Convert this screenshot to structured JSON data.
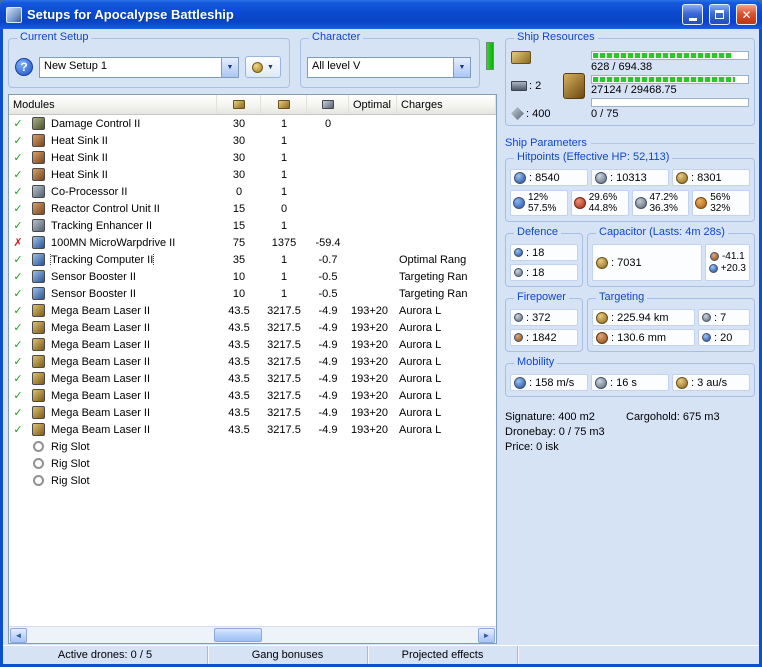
{
  "window": {
    "title": "Setups for Apocalypse Battleship"
  },
  "setup": {
    "group_label": "Current Setup",
    "value": "New Setup 1",
    "help_label": "?"
  },
  "character": {
    "group_label": "Character",
    "value": "All level V"
  },
  "modules": {
    "header_label": "Modules",
    "col_optimal": "Optimal",
    "col_charges": "Charges",
    "rows": [
      {
        "status": "ok",
        "icon": "dc",
        "name": "Damage Control II",
        "cpu": "30",
        "pg": "1",
        "cap": "0"
      },
      {
        "status": "ok",
        "icon": "hs",
        "name": "Heat Sink II",
        "cpu": "30",
        "pg": "1"
      },
      {
        "status": "ok",
        "icon": "hs",
        "name": "Heat Sink II",
        "cpu": "30",
        "pg": "1"
      },
      {
        "status": "ok",
        "icon": "hs",
        "name": "Heat Sink II",
        "cpu": "30",
        "pg": "1"
      },
      {
        "status": "ok",
        "icon": "cp",
        "name": "Co-Processor II",
        "cpu": "0",
        "pg": "1"
      },
      {
        "status": "ok",
        "icon": "rcu",
        "name": "Reactor Control Unit II",
        "cpu": "15",
        "pg": "0"
      },
      {
        "status": "ok",
        "icon": "te",
        "name": "Tracking Enhancer II",
        "cpu": "15",
        "pg": "1"
      },
      {
        "status": "error",
        "icon": "mwd",
        "name": "100MN MicroWarpdrive II",
        "cpu": "75",
        "pg": "1375",
        "cap": "-59.4"
      },
      {
        "status": "ok",
        "icon": "tc",
        "name": "Tracking Computer II",
        "cpu": "35",
        "pg": "1",
        "cap": "-0.7",
        "charge": "Optimal Rang",
        "selected": true
      },
      {
        "status": "ok",
        "icon": "sb",
        "name": "Sensor Booster II",
        "cpu": "10",
        "pg": "1",
        "cap": "-0.5",
        "charge": "Targeting Ran"
      },
      {
        "status": "ok",
        "icon": "sb",
        "name": "Sensor Booster II",
        "cpu": "10",
        "pg": "1",
        "cap": "-0.5",
        "charge": "Targeting Ran"
      },
      {
        "status": "ok",
        "icon": "laser",
        "name": "Mega Beam Laser II",
        "cpu": "43.5",
        "pg": "3217.5",
        "cap": "-4.9",
        "optimal": "193+20",
        "charge": "Aurora L"
      },
      {
        "status": "ok",
        "icon": "laser",
        "name": "Mega Beam Laser II",
        "cpu": "43.5",
        "pg": "3217.5",
        "cap": "-4.9",
        "optimal": "193+20",
        "charge": "Aurora L"
      },
      {
        "status": "ok",
        "icon": "laser",
        "name": "Mega Beam Laser II",
        "cpu": "43.5",
        "pg": "3217.5",
        "cap": "-4.9",
        "optimal": "193+20",
        "charge": "Aurora L"
      },
      {
        "status": "ok",
        "icon": "laser",
        "name": "Mega Beam Laser II",
        "cpu": "43.5",
        "pg": "3217.5",
        "cap": "-4.9",
        "optimal": "193+20",
        "charge": "Aurora L"
      },
      {
        "status": "ok",
        "icon": "laser",
        "name": "Mega Beam Laser II",
        "cpu": "43.5",
        "pg": "3217.5",
        "cap": "-4.9",
        "optimal": "193+20",
        "charge": "Aurora L"
      },
      {
        "status": "ok",
        "icon": "laser",
        "name": "Mega Beam Laser II",
        "cpu": "43.5",
        "pg": "3217.5",
        "cap": "-4.9",
        "optimal": "193+20",
        "charge": "Aurora L"
      },
      {
        "status": "ok",
        "icon": "laser",
        "name": "Mega Beam Laser II",
        "cpu": "43.5",
        "pg": "3217.5",
        "cap": "-4.9",
        "optimal": "193+20",
        "charge": "Aurora L"
      },
      {
        "status": "ok",
        "icon": "laser",
        "name": "Mega Beam Laser II",
        "cpu": "43.5",
        "pg": "3217.5",
        "cap": "-4.9",
        "optimal": "193+20",
        "charge": "Aurora L"
      },
      {
        "icon": "rig",
        "name": "Rig Slot"
      },
      {
        "icon": "rig",
        "name": "Rig Slot"
      },
      {
        "icon": "rig",
        "name": "Rig Slot"
      }
    ]
  },
  "ship_resources": {
    "group_label": "Ship Resources",
    "turret_value": ": 2",
    "drone_value": ": 400",
    "cpu_text": "628 / 694.38",
    "cpu_pct": 90,
    "pg_text": "27124 / 29468.75",
    "pg_pct": 92,
    "calibration_text": "0 / 75",
    "calibration_pct": 0
  },
  "ship_parameters": {
    "label": "Ship Parameters",
    "hitpoints": {
      "group_label": "Hitpoints (Effective HP: 52,113)",
      "shield": ": 8540",
      "armor": ": 10313",
      "hull": ": 8301",
      "resists": [
        {
          "top": "12%",
          "bottom": "57.5%"
        },
        {
          "top": "29.6%",
          "bottom": "44.8%"
        },
        {
          "top": "47.2%",
          "bottom": "36.3%"
        },
        {
          "top": "56%",
          "bottom": "32%"
        }
      ]
    },
    "defence": {
      "group_label": "Defence",
      "v1": ": 18",
      "v2": ": 18"
    },
    "capacitor": {
      "group_label": "Capacitor (Lasts: 4m 28s)",
      "amount": ": 7031",
      "drain": "-41.1",
      "recharge": "+20.3"
    },
    "firepower": {
      "group_label": "Firepower",
      "volley": ": 372",
      "dps": ": 1842"
    },
    "targeting": {
      "group_label": "Targeting",
      "range": ": 225.94 km",
      "max_targets": ": 7",
      "scan_resolution": ": 130.6 mm",
      "sensor_strength": ": 20"
    },
    "mobility": {
      "group_label": "Mobility",
      "speed": ": 158 m/s",
      "align_time": ": 16 s",
      "warp_speed": ": 3 au/s"
    },
    "signature": "Signature: 400 m2",
    "cargohold": "Cargohold: 675 m3",
    "dronebay": "Dronebay: 0 / 75 m3",
    "price": "Price: 0 isk"
  },
  "statusbar": {
    "drones": "Active drones: 0 / 5",
    "gang": "Gang bonuses",
    "projected": "Projected effects"
  },
  "colors": {
    "accent_blue": "#1047c8",
    "ok_green": "#1d9e1d",
    "error_red": "#d42020",
    "meter_green": "#2dc42d"
  }
}
